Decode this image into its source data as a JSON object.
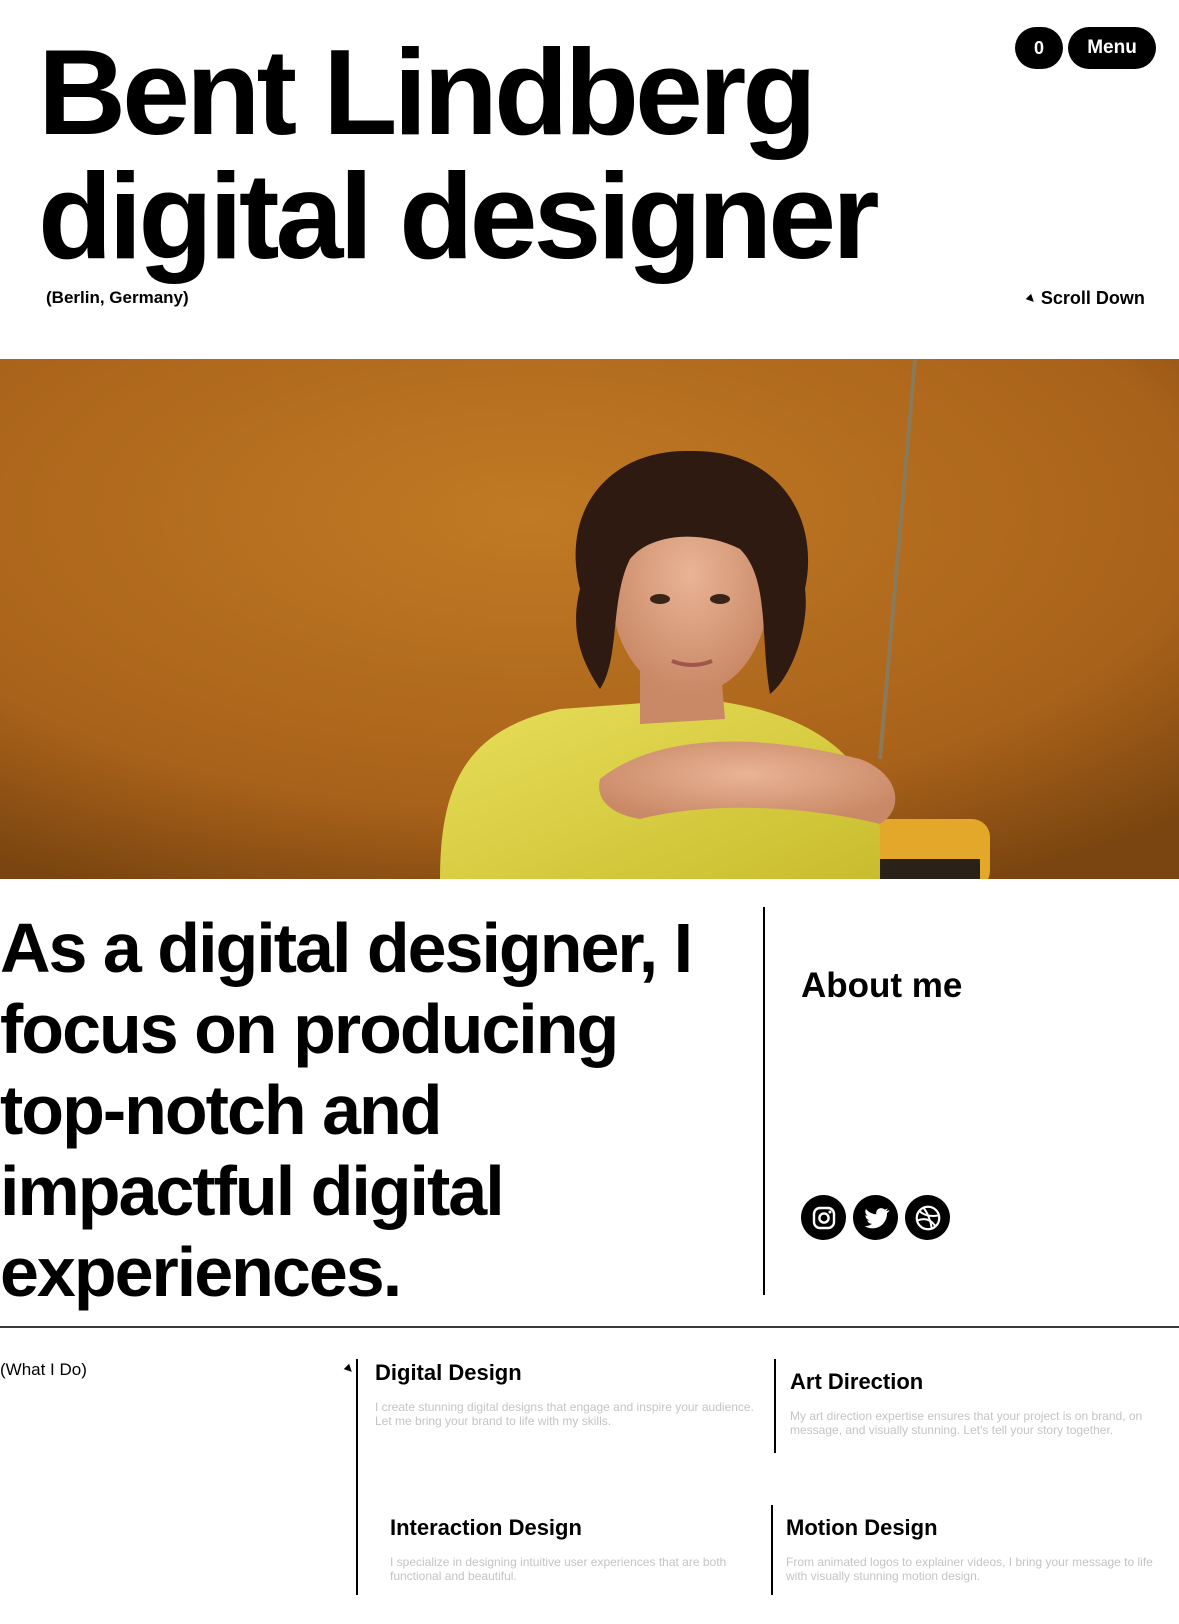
{
  "header": {
    "title_line1": "Bent Lindberg",
    "title_line2": "digital designer",
    "location": "(Berlin, Germany)",
    "cart_count": "0",
    "menu_label": "Menu",
    "scroll_label": "Scroll Down"
  },
  "hero_image": {
    "description_icon": "portrait-photo",
    "background_color": "#b46a1a"
  },
  "statement": {
    "lines": [
      "As a digital designer, I",
      "focus on producing",
      "top-notch and",
      "impactful digital",
      "experiences."
    ]
  },
  "about": {
    "heading": "About me",
    "socials": [
      "instagram-icon",
      "twitter-icon",
      "dribbble-icon"
    ]
  },
  "services": {
    "section_label": "(What I Do)",
    "items": [
      {
        "title": "Digital Design",
        "desc": "I create stunning digital designs that engage and inspire your audience. Let me bring your brand to life with my skills."
      },
      {
        "title": "Art Direction",
        "desc": "My art direction expertise ensures that your project is on brand, on message, and visually stunning. Let's tell your story together."
      },
      {
        "title": "Interaction Design",
        "desc": "I specialize in designing intuitive user experiences that are both functional and beautiful."
      },
      {
        "title": "Motion Design",
        "desc": "From animated logos to explainer videos, I bring your message to life with visually stunning motion design."
      }
    ]
  }
}
